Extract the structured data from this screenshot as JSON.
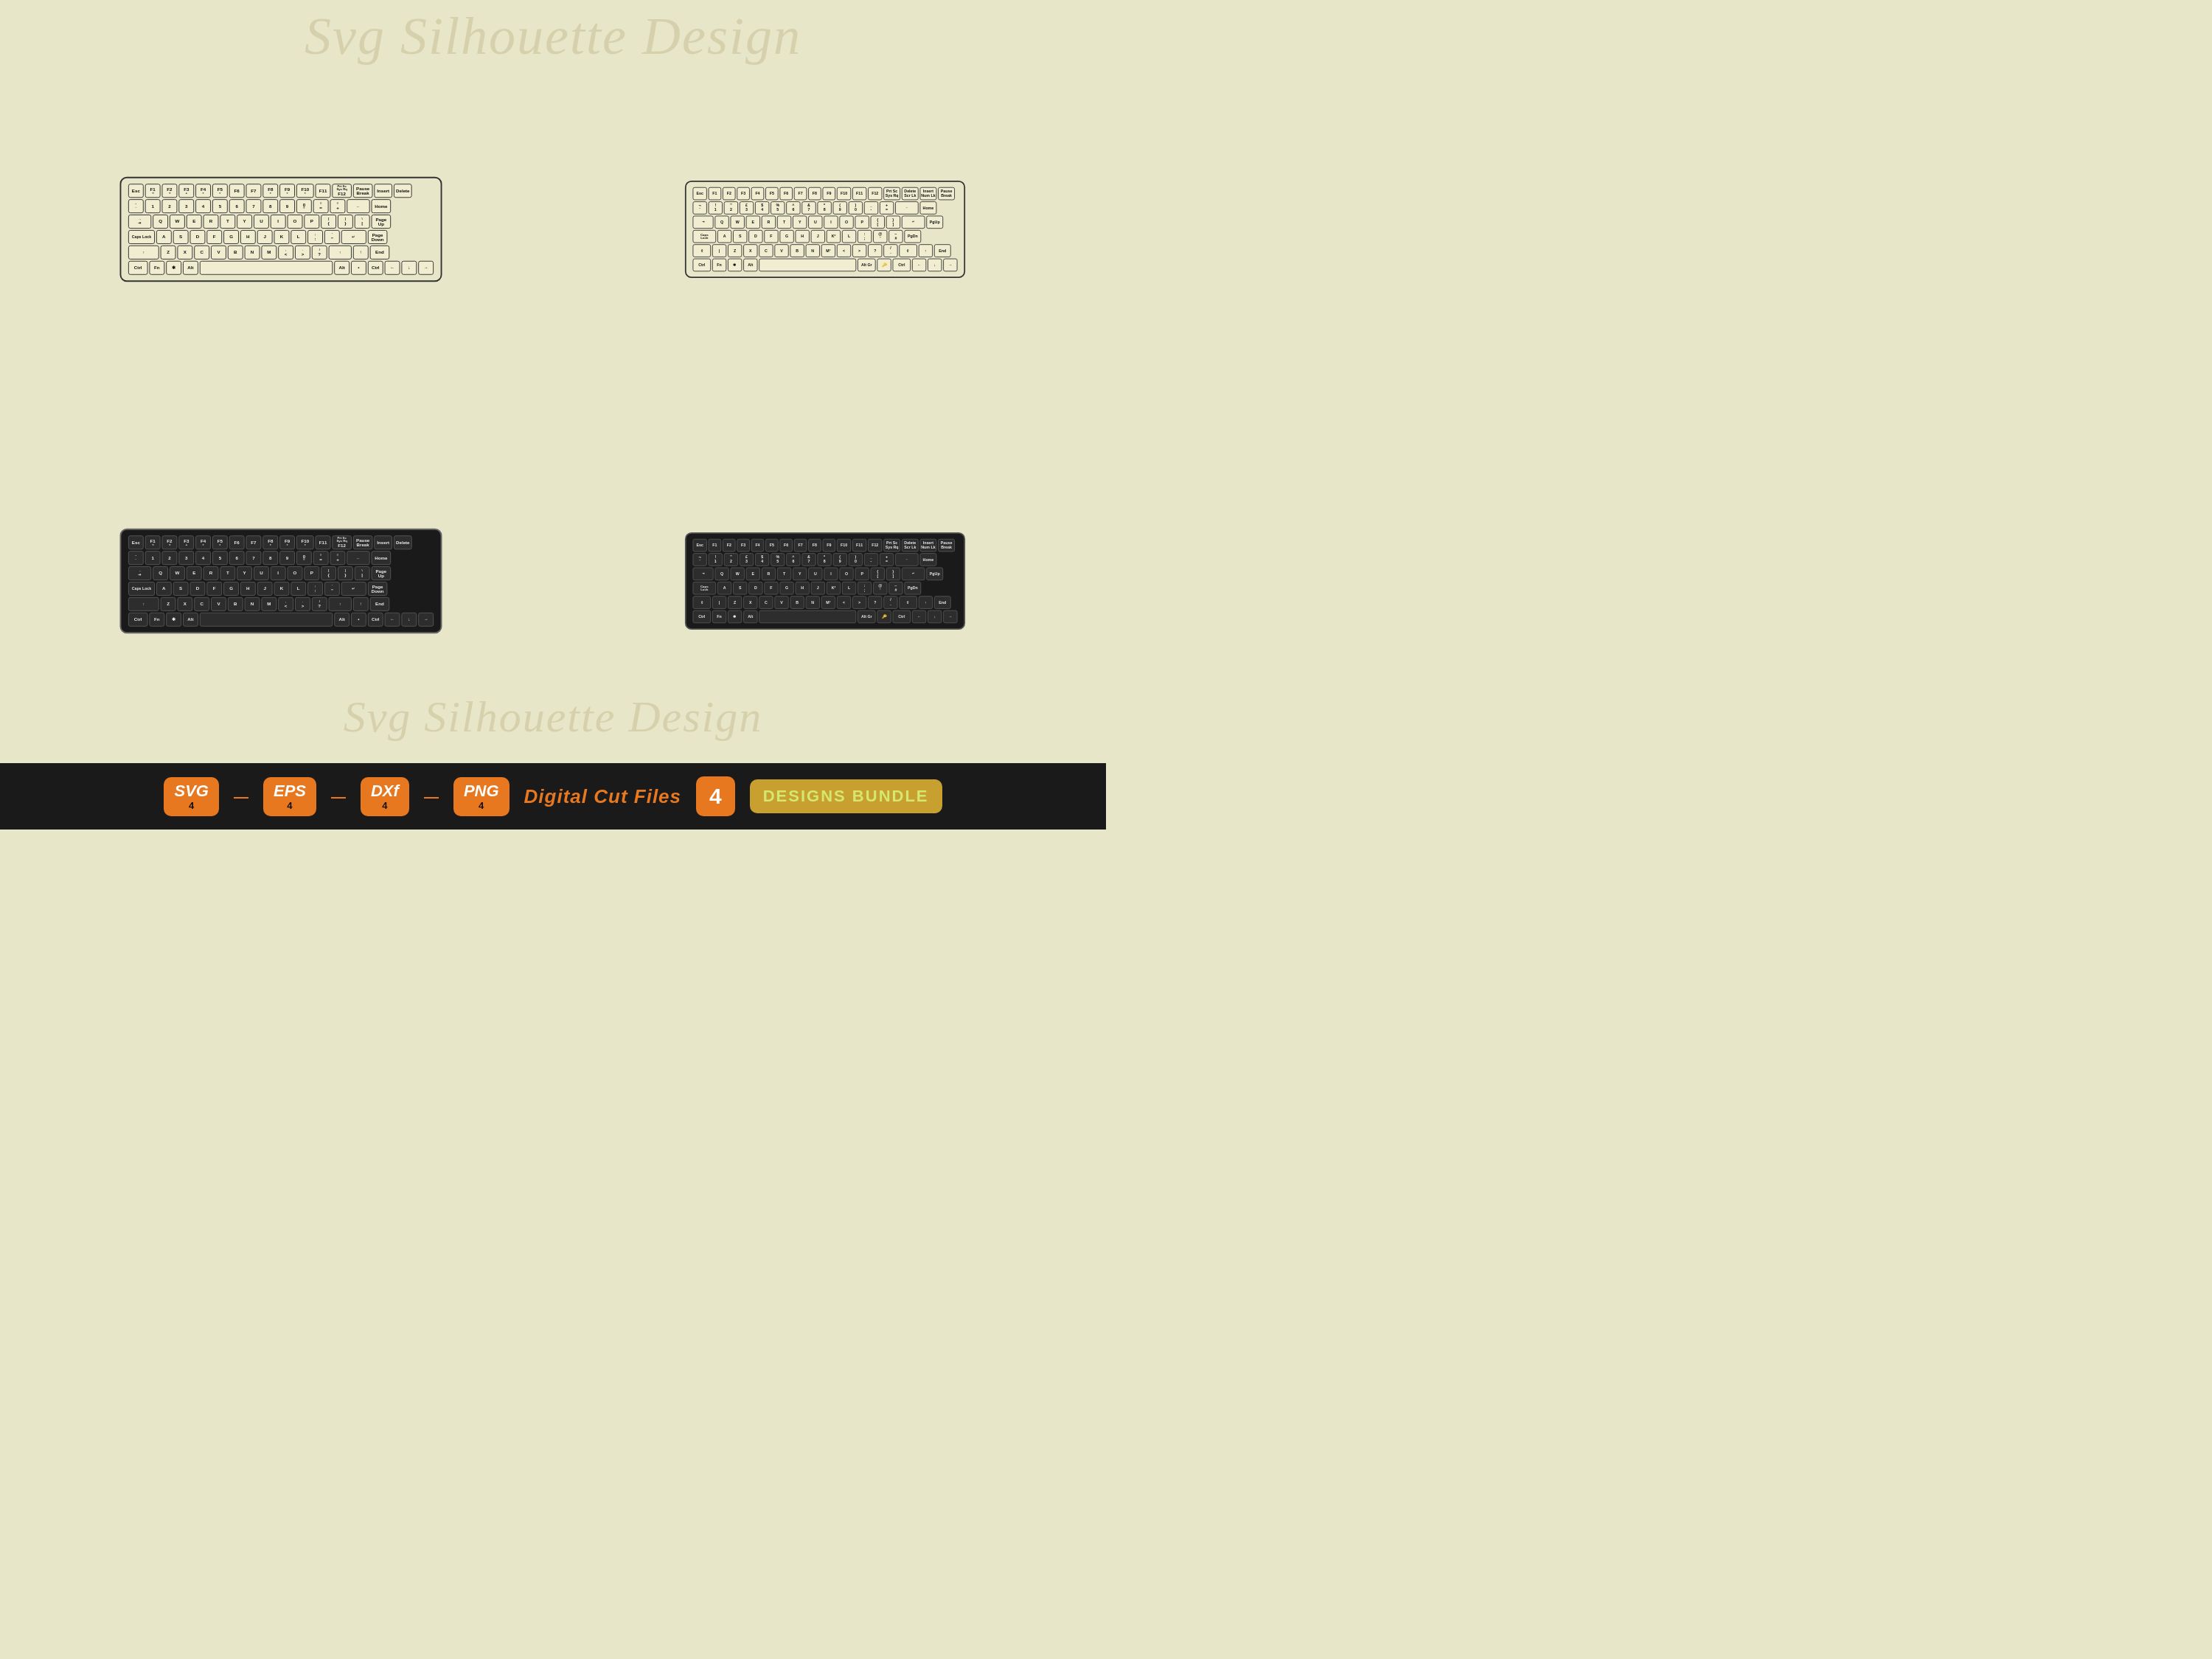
{
  "watermark": {
    "top": "Svg Silhouette Design",
    "bottom": "Svg Silhouette Design"
  },
  "keyboards": [
    {
      "id": "kb-tl",
      "theme": "light",
      "type": "compact",
      "position": "top-left"
    },
    {
      "id": "kb-tr",
      "theme": "light",
      "type": "extended",
      "position": "top-right"
    },
    {
      "id": "kb-bl",
      "theme": "dark",
      "type": "compact",
      "position": "bottom-left"
    },
    {
      "id": "kb-br",
      "theme": "dark",
      "type": "extended",
      "position": "bottom-right"
    }
  ],
  "banner": {
    "formats": [
      "SVG",
      "EPS",
      "DXf",
      "PNG"
    ],
    "counts": [
      "4",
      "4",
      "4",
      "4"
    ],
    "digitalText": "Digital Cut Files",
    "number": "4",
    "designsLabel": "DESIGNS BUNDLE"
  }
}
